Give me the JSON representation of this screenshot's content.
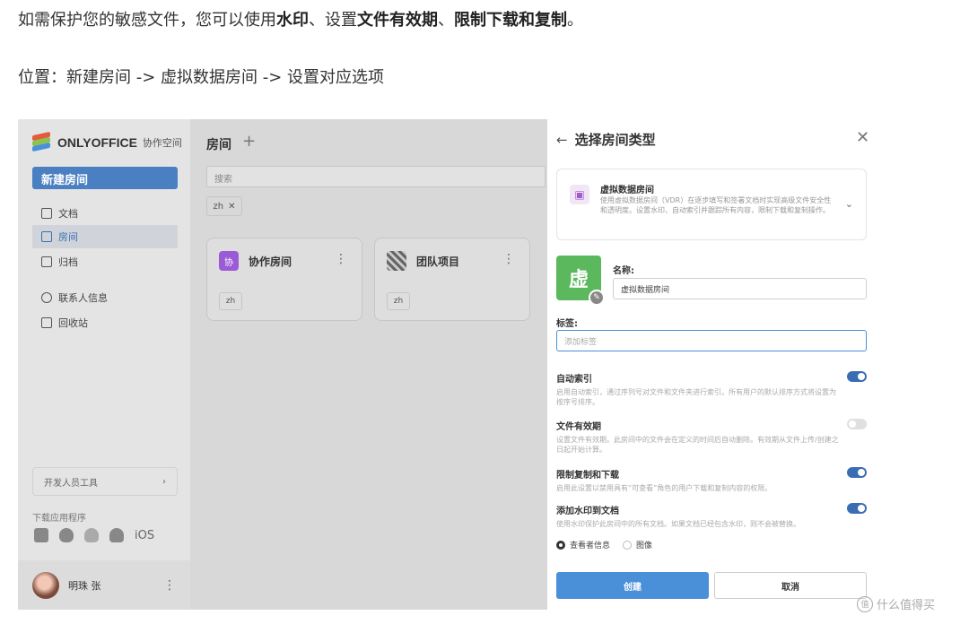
{
  "article": {
    "line1_prefix": "如需保护您的敏感文件，您可以使用",
    "line1_b1": "水印",
    "line1_mid": "、设置",
    "line1_b2": "文件有效期",
    "line1_sep": "、",
    "line1_b3": "限制下载和复制",
    "line1_end": "。",
    "line2": "位置：新建房间 -> 虚拟数据房间 -> 设置对应选项"
  },
  "sidebar": {
    "logo": "ONLYOFFICE",
    "logo_sub": "协作空间",
    "new_room": "新建房间",
    "items": [
      {
        "label": "文档"
      },
      {
        "label": "房间"
      },
      {
        "label": "归档"
      },
      {
        "label": "联系人信息"
      },
      {
        "label": "回收站"
      }
    ],
    "dev_tools": "开发人员工具",
    "download_label": "下载应用程序",
    "ios": "iOS",
    "user_name": "明珠 张"
  },
  "main": {
    "title": "房间",
    "search_placeholder": "搜索",
    "chip": "zh",
    "rooms": [
      {
        "title": "协作房间",
        "icon": "协",
        "tag": "zh"
      },
      {
        "title": "团队项目",
        "icon": "",
        "tag": "zh"
      }
    ]
  },
  "panel": {
    "title": "选择房间类型",
    "type_name": "虚拟数据房间",
    "type_desc": "使用虚拟数据房间（VDR）在逐步填写和签署文档时实现高级文件安全性和透明度。设置水印、自动索引并跟踪所有内容，限制下载和复制操作。",
    "logo_char": "虚",
    "name_label": "名称:",
    "name_value": "虚拟数据房间",
    "tags_label": "标签:",
    "tags_placeholder": "添加标签",
    "options": [
      {
        "title": "自动索引",
        "desc": "启用自动索引，通过序列号对文件和文件夹进行索引。所有用户的默认排序方式将设置为按序号排序。",
        "on": true
      },
      {
        "title": "文件有效期",
        "desc": "设置文件有效期。此房间中的文件会在定义的时间后自动删除。有效期从文件上传/创建之日起开始计算。",
        "on": false
      },
      {
        "title": "限制复制和下载",
        "desc": "启用此设置以禁用具有“可查看”角色的用户下载和复制内容的权限。",
        "on": true
      },
      {
        "title": "添加水印到文档",
        "desc": "使用水印保护此房间中的所有文档。如果文档已经包含水印，则不会被替换。",
        "on": true
      }
    ],
    "radio_viewer": "查看者信息",
    "radio_image": "图像",
    "create": "创建",
    "cancel": "取消"
  },
  "watermark": "什么值得买"
}
